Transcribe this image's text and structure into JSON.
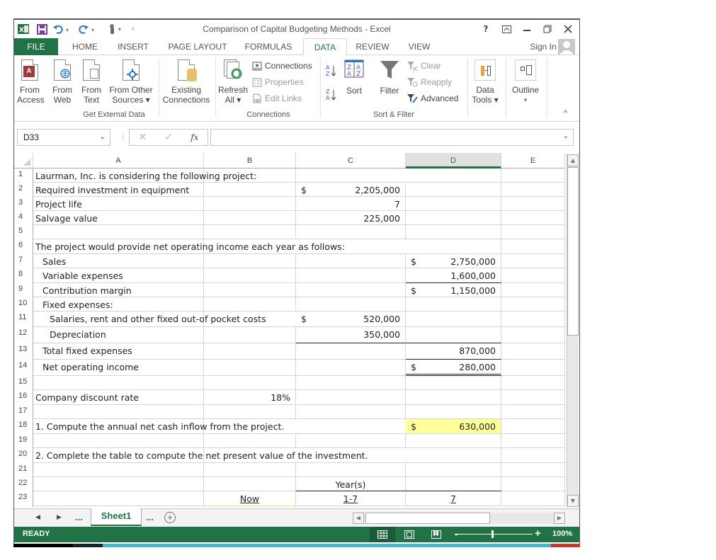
{
  "window": {
    "title": "Comparison of Capital Budgeting Methods - Excel",
    "help_label": "?",
    "controls": [
      "ribbon-display-options",
      "minimize",
      "restore",
      "close"
    ]
  },
  "quick_access": {
    "icons": [
      "excel-logo-icon",
      "save-icon",
      "undo-icon",
      "redo-icon",
      "touch-mode-icon",
      "customize-qat-icon"
    ]
  },
  "tabs": [
    {
      "label": "FILE"
    },
    {
      "label": "HOME"
    },
    {
      "label": "INSERT"
    },
    {
      "label": "PAGE LAYOUT"
    },
    {
      "label": "FORMULAS"
    },
    {
      "label": "DATA",
      "active": true
    },
    {
      "label": "REVIEW"
    },
    {
      "label": "VIEW"
    }
  ],
  "account": {
    "sign_in": "Sign In"
  },
  "ribbon": {
    "get_external_data": {
      "label": "Get External Data",
      "from_access_1": "From",
      "from_access_2": "Access",
      "from_web_1": "From",
      "from_web_2": "Web",
      "from_text_1": "From",
      "from_text_2": "Text",
      "from_other_1": "From Other",
      "from_other_2": "Sources ▾",
      "existing_1": "Existing",
      "existing_2": "Connections"
    },
    "connections": {
      "label": "Connections",
      "refresh_1": "Refresh",
      "refresh_2": "All ▾",
      "connections": "Connections",
      "properties": "Properties",
      "edit_links": "Edit Links"
    },
    "sort_filter": {
      "label": "Sort & Filter",
      "sort": "Sort",
      "filter": "Filter",
      "clear": "Clear",
      "reapply": "Reapply",
      "advanced": "Advanced"
    },
    "data_tools": {
      "label_1": "Data",
      "label_2": "Tools ▾"
    },
    "outline": {
      "label_1": "Outline",
      "label_2": "▾"
    },
    "collapse": "^"
  },
  "formula_bar": {
    "name_box": "D33",
    "formula": "",
    "fx": "fx"
  },
  "columns": [
    "A",
    "B",
    "C",
    "D",
    "E"
  ],
  "selected_column": "D",
  "rows": [
    {
      "n": "1",
      "a": "Laurman, Inc. is considering the following project:"
    },
    {
      "n": "2",
      "a": "Required investment in equipment",
      "c_cur": "$",
      "c": "2,205,000"
    },
    {
      "n": "3",
      "a": "Project life",
      "c": "7"
    },
    {
      "n": "4",
      "a": "Salvage value",
      "c": "225,000"
    },
    {
      "n": "5"
    },
    {
      "n": "6",
      "a": "The project would provide net operating income each year as follows:"
    },
    {
      "n": "7",
      "a": "Sales",
      "d_cur": "$",
      "d": "2,750,000"
    },
    {
      "n": "8",
      "a": "Variable expenses",
      "d": "1,600,000"
    },
    {
      "n": "9",
      "a": "Contribution margin",
      "d_cur": "$",
      "d": "1,150,000"
    },
    {
      "n": "10",
      "a": "Fixed expenses:"
    },
    {
      "n": "11",
      "a": "Salaries, rent and other fixed out-of pocket costs",
      "c_cur": "$",
      "c": "520,000"
    },
    {
      "n": "12",
      "a": "Depreciation",
      "c": "350,000"
    },
    {
      "n": "13",
      "a": "Total fixed expenses",
      "d": "870,000"
    },
    {
      "n": "14",
      "a": "Net operating income",
      "d_cur": "$",
      "d": "280,000"
    },
    {
      "n": "15"
    },
    {
      "n": "16",
      "a": "Company discount rate",
      "b": "18%"
    },
    {
      "n": "17"
    },
    {
      "n": "18",
      "a": "1. Compute the annual net cash inflow from the project.",
      "d_cur": "$",
      "d": "630,000"
    },
    {
      "n": "19"
    },
    {
      "n": "20",
      "a": "2. Complete the table to compute the net present value of the investment."
    },
    {
      "n": "21"
    },
    {
      "n": "22",
      "c": "Year(s)"
    },
    {
      "n": "23",
      "b": "Now",
      "c": "1-7",
      "d": "7"
    }
  ],
  "sheets": {
    "active": "Sheet1",
    "more": "...",
    "add": "+"
  },
  "status": {
    "ready": "READY",
    "zoom": "100%",
    "zoom_level_percent": 100
  }
}
